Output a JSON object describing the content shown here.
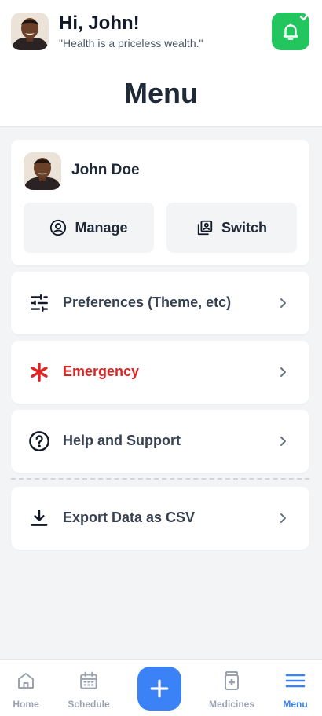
{
  "header": {
    "greeting": "Hi, John!",
    "quote": "\"Health is a priceless wealth.\"",
    "notification_status": "check"
  },
  "page_title": "Menu",
  "profile": {
    "name": "John Doe",
    "manage_label": "Manage",
    "switch_label": "Switch"
  },
  "menu": {
    "preferences": "Preferences (Theme, etc)",
    "emergency": "Emergency",
    "help": "Help and Support",
    "export": "Export Data as CSV"
  },
  "nav": {
    "home": "Home",
    "schedule": "Schedule",
    "medicines": "Medicines",
    "menu": "Menu"
  },
  "colors": {
    "accent": "#3b82f6",
    "bell": "#22c55e",
    "danger": "#dc2626"
  }
}
